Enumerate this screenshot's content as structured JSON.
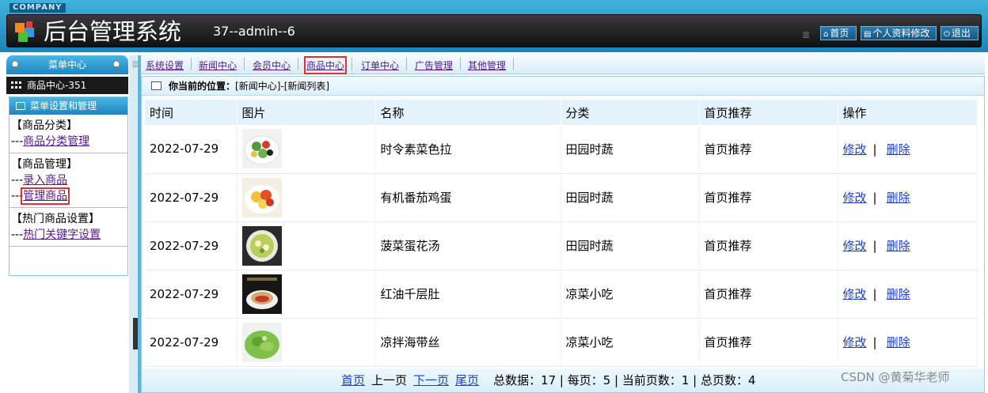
{
  "header": {
    "company": "COMPANY",
    "title": "后台管理系统",
    "user": "37--admin--6",
    "home": "首页",
    "profile": "个人资料修改",
    "logout": "退出"
  },
  "sidebar": {
    "menu_center": "菜单中心",
    "section": "商品中心-351",
    "box_title": "菜单设置和管理",
    "groups": [
      {
        "title": "【商品分类】",
        "items": [
          "商品分类管理"
        ]
      },
      {
        "title": "【商品管理】",
        "items": [
          "录入商品",
          "管理商品"
        ]
      },
      {
        "title": "【热门商品设置】",
        "items": [
          "热门关键字设置"
        ]
      }
    ]
  },
  "nav": {
    "tabs": [
      "系统设置",
      "新闻中心",
      "会员中心",
      "商品中心",
      "订单中心",
      "广告管理",
      "其他管理"
    ]
  },
  "location": {
    "label": "你当前的位置：",
    "path": "[新闻中心]-[新闻列表]"
  },
  "table": {
    "headers": [
      "时间",
      "图片",
      "名称",
      "分类",
      "首页推荐",
      "操作"
    ],
    "rows": [
      {
        "date": "2022-07-29",
        "name": "时令素菜色拉",
        "category": "田园时蔬",
        "recommend": "首页推荐",
        "image": "salad-image"
      },
      {
        "date": "2022-07-29",
        "name": "有机番茄鸡蛋",
        "category": "田园时蔬",
        "recommend": "首页推荐",
        "image": "tomato-egg-image"
      },
      {
        "date": "2022-07-29",
        "name": "菠菜蛋花汤",
        "category": "田园时蔬",
        "recommend": "首页推荐",
        "image": "spinach-soup-image"
      },
      {
        "date": "2022-07-29",
        "name": "红油千层肚",
        "category": "凉菜小吃",
        "recommend": "首页推荐",
        "image": "tripe-image"
      },
      {
        "date": "2022-07-29",
        "name": "凉拌海带丝",
        "category": "凉菜小吃",
        "recommend": "首页推荐",
        "image": "kelp-image"
      }
    ],
    "edit": "修改",
    "delete": "删除",
    "op_sep": "|"
  },
  "pager": {
    "first": "首页",
    "prev": "上一页",
    "next": "下一页",
    "last": "尾页",
    "stats": "总数据：17 | 每页：5 | 当前页数：1 | 总页数：4"
  },
  "watermark": "CSDN @黄菊华老师",
  "colors": {
    "accent": "#1b84b8",
    "header_dark": "#111111",
    "link": "#1a3fd1",
    "highlight": "#e03030"
  }
}
